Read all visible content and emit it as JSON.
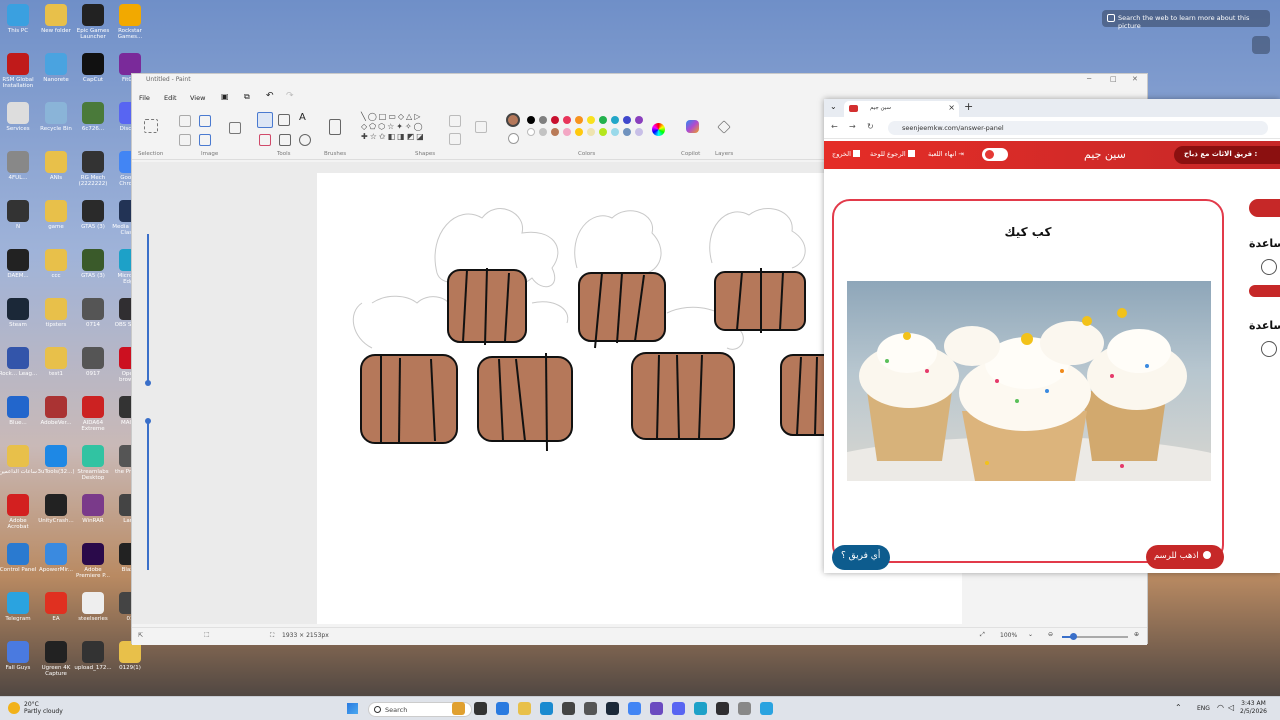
{
  "desktop": {
    "icons": [
      {
        "label": "This PC",
        "color": "#3aa0e0"
      },
      {
        "label": "New folder",
        "color": "#e8c04a"
      },
      {
        "label": "Epic Games Launcher",
        "color": "#222222"
      },
      {
        "label": "Rockstar Games...",
        "color": "#f2a900"
      },
      {
        "label": "RSM Global Installation",
        "color": "#c01a1a"
      },
      {
        "label": "Nanorete",
        "color": "#4aa3e0"
      },
      {
        "label": "CapCut",
        "color": "#111111"
      },
      {
        "label": "FitGirl",
        "color": "#7a2a9a"
      },
      {
        "label": "Services",
        "color": "#dddddd"
      },
      {
        "label": "Recycle Bin",
        "color": "#8ab4d8"
      },
      {
        "label": "6c726...",
        "color": "#4a7a3a"
      },
      {
        "label": "Discord",
        "color": "#5865f2"
      },
      {
        "label": "4FUL...",
        "color": "#888888"
      },
      {
        "label": "ANIs",
        "color": "#e8c04a"
      },
      {
        "label": "RG Mech (2222222)",
        "color": "#333333"
      },
      {
        "label": "Google Chrome",
        "color": "#4285f4"
      },
      {
        "label": "N",
        "color": "#333333"
      },
      {
        "label": "game",
        "color": "#e8c04a"
      },
      {
        "label": "GTA5 (3)",
        "color": "#2a2a2a"
      },
      {
        "label": "Media Player Classic",
        "color": "#223355"
      },
      {
        "label": "DAEM...",
        "color": "#222222"
      },
      {
        "label": "ccc",
        "color": "#e8c04a"
      },
      {
        "label": "GTA5 (3)",
        "color": "#3a5a2a"
      },
      {
        "label": "Microsoft Edge",
        "color": "#1da1c8"
      },
      {
        "label": "Steam",
        "color": "#1b2838"
      },
      {
        "label": "tipsters",
        "color": "#e8c04a"
      },
      {
        "label": "0714",
        "color": "#555555"
      },
      {
        "label": "OBS Studio",
        "color": "#302e31"
      },
      {
        "label": "Rock... Leag...",
        "color": "#3355aa"
      },
      {
        "label": "test1",
        "color": "#e8c04a"
      },
      {
        "label": "0917",
        "color": "#555555"
      },
      {
        "label": "Opera browser",
        "color": "#cc1020"
      },
      {
        "label": "Blue...",
        "color": "#2266cc"
      },
      {
        "label": "AdobeVer...",
        "color": "#aa3333"
      },
      {
        "label": "AIDA64 Extreme",
        "color": "#cc2222"
      },
      {
        "label": "MAG...",
        "color": "#333333"
      },
      {
        "label": "ساعات الداعمين",
        "color": "#e8c04a"
      },
      {
        "label": "3uTools(32...)",
        "color": "#1e88e5"
      },
      {
        "label": "Streamlabs Desktop",
        "color": "#31c3a2"
      },
      {
        "label": "the Profe...",
        "color": "#555555"
      },
      {
        "label": "Adobe Acrobat",
        "color": "#d32020"
      },
      {
        "label": "UnityCrash...",
        "color": "#222222"
      },
      {
        "label": "WinRAR",
        "color": "#7a3a8a"
      },
      {
        "label": "Lar...",
        "color": "#444444"
      },
      {
        "label": "Control Panel",
        "color": "#2a7ad0"
      },
      {
        "label": "ApowerMir...",
        "color": "#3a8ae0"
      },
      {
        "label": "Adobe Premiere P...",
        "color": "#2a0a4a"
      },
      {
        "label": "Blaz...",
        "color": "#222222"
      },
      {
        "label": "Telegram",
        "color": "#2aa3e0"
      },
      {
        "label": "EA",
        "color": "#e03020"
      },
      {
        "label": "steelseries",
        "color": "#eeeeee"
      },
      {
        "label": "01",
        "color": "#444444"
      },
      {
        "label": "Fall Guys",
        "color": "#4a7ae0"
      },
      {
        "label": "Ugreen 4K Capture",
        "color": "#222222"
      },
      {
        "label": "upload_172...",
        "color": "#333333"
      },
      {
        "label": "0129(1)",
        "color": "#e8c04a"
      }
    ],
    "lens_text": "Search the web to learn more about this picture"
  },
  "paint": {
    "title": "Untitled - Paint",
    "menu": {
      "file": "File",
      "edit": "Edit",
      "view": "View"
    },
    "ribbon": {
      "selection": "Selection",
      "image": "Image",
      "tools": "Tools",
      "brushes": "Brushes",
      "shapes": "Shapes",
      "colors": "Colors",
      "copilot": "Copilot",
      "layers": "Layers"
    },
    "palette": [
      "#000000",
      "#7f7f7f",
      "#c8102e",
      "#e8345a",
      "#f7931e",
      "#f9e11e",
      "#22b14c",
      "#22a6c8",
      "#3f48cc",
      "#8a3fbd",
      "#ffffff",
      "#c3c3c3",
      "#b97a57",
      "#f3a7c4",
      "#ffc90e",
      "#efe4b0",
      "#b5e61d",
      "#99d9ea",
      "#7092be",
      "#c8bfe7"
    ],
    "current_color": "#b5785a",
    "status": {
      "dimensions": "1933 × 2153px",
      "zoom": "100%"
    }
  },
  "browser": {
    "tab_title": "سين جيم",
    "url": "seenjeemkw.com/answer-panel",
    "header": {
      "brand": "سين جيم",
      "exit": "الخروج",
      "back_to_board": "الرجوع للوحة",
      "end_game": "انهاء اللعبة",
      "team_pill": "فريق الاثاث مع ذباح :"
    },
    "card": {
      "word": "كب كيك",
      "team_button": "أي فريق ؟",
      "draw_button": "اذهب للرسم"
    },
    "side": {
      "help1": "ساعدة",
      "help2": "ساعدة"
    }
  },
  "taskbar": {
    "weather_temp": "20°C",
    "weather_desc": "Partly cloudy",
    "search": "Search",
    "lang": "ENG",
    "time": "3:43 AM",
    "date": "2/5/2026"
  }
}
